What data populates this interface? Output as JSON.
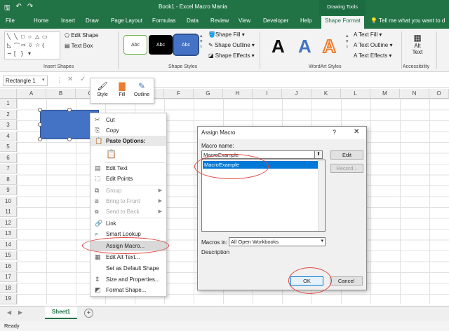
{
  "window": {
    "title": "Book1 - Excel Macro Mania",
    "contextual_tab_group": "Drawing Tools",
    "accent_color": "#217346"
  },
  "tabs": [
    "File",
    "Home",
    "Insert",
    "Draw",
    "Page Layout",
    "Formulas",
    "Data",
    "Review",
    "View",
    "Developer",
    "Help",
    "Shape Format"
  ],
  "active_tab": "Shape Format",
  "tell_me": "Tell me what you want to d",
  "ribbon": {
    "groups": [
      "Insert Shapes",
      "Shape Styles",
      "WordArt Styles",
      "Accessibility"
    ],
    "edit_shape": "Edit Shape",
    "text_box": "Text Box",
    "shape_fill": "Shape Fill",
    "shape_outline": "Shape Outline",
    "shape_effects": "Shape Effects",
    "style_sample": "Abc",
    "text_fill": "Text Fill",
    "text_outline": "Text Outline",
    "text_effects": "Text Effects",
    "wordart_sample": "A",
    "alt_text": "Alt Text"
  },
  "formula_bar": {
    "name_box": "Rectangle 1"
  },
  "columns": [
    "A",
    "B",
    "C",
    "D",
    "E",
    "F",
    "G",
    "H",
    "I",
    "J",
    "K",
    "L",
    "M",
    "N",
    "O"
  ],
  "rows": [
    "1",
    "2",
    "3",
    "4",
    "5",
    "6",
    "7",
    "8",
    "9",
    "10",
    "11",
    "12",
    "13",
    "14",
    "15",
    "16",
    "17",
    "18",
    "19",
    "20",
    "21"
  ],
  "mini_toolbar": {
    "style": "Style",
    "fill": "Fill",
    "outline": "Outline"
  },
  "context_menu": {
    "cut": "Cut",
    "copy": "Copy",
    "paste_options": "Paste Options:",
    "edit_text": "Edit Text",
    "edit_points": "Edit Points",
    "group": "Group",
    "bring_to_front": "Bring to Front",
    "send_to_back": "Send to Back",
    "link": "Link",
    "smart_lookup": "Smart Lookup",
    "assign_macro": "Assign Macro...",
    "edit_alt_text": "Edit Alt Text...",
    "set_default_shape": "Set as Default Shape",
    "size_properties": "Size and Properties...",
    "format_shape": "Format Shape..."
  },
  "dialog": {
    "title": "Assign Macro",
    "help": "?",
    "close": "✕",
    "macro_name_label": "Macro name:",
    "macro_name_value": "MacroExample",
    "macro_list": [
      "MacroExample"
    ],
    "edit": "Edit",
    "record": "Record...",
    "macros_in_label": "Macros in:",
    "macros_in_value": "All Open Workbooks",
    "description_label": "Description",
    "ok": "OK",
    "cancel": "Cancel"
  },
  "sheets": [
    "Sheet1"
  ],
  "status": "Ready",
  "annotation_color": "#e0473f"
}
